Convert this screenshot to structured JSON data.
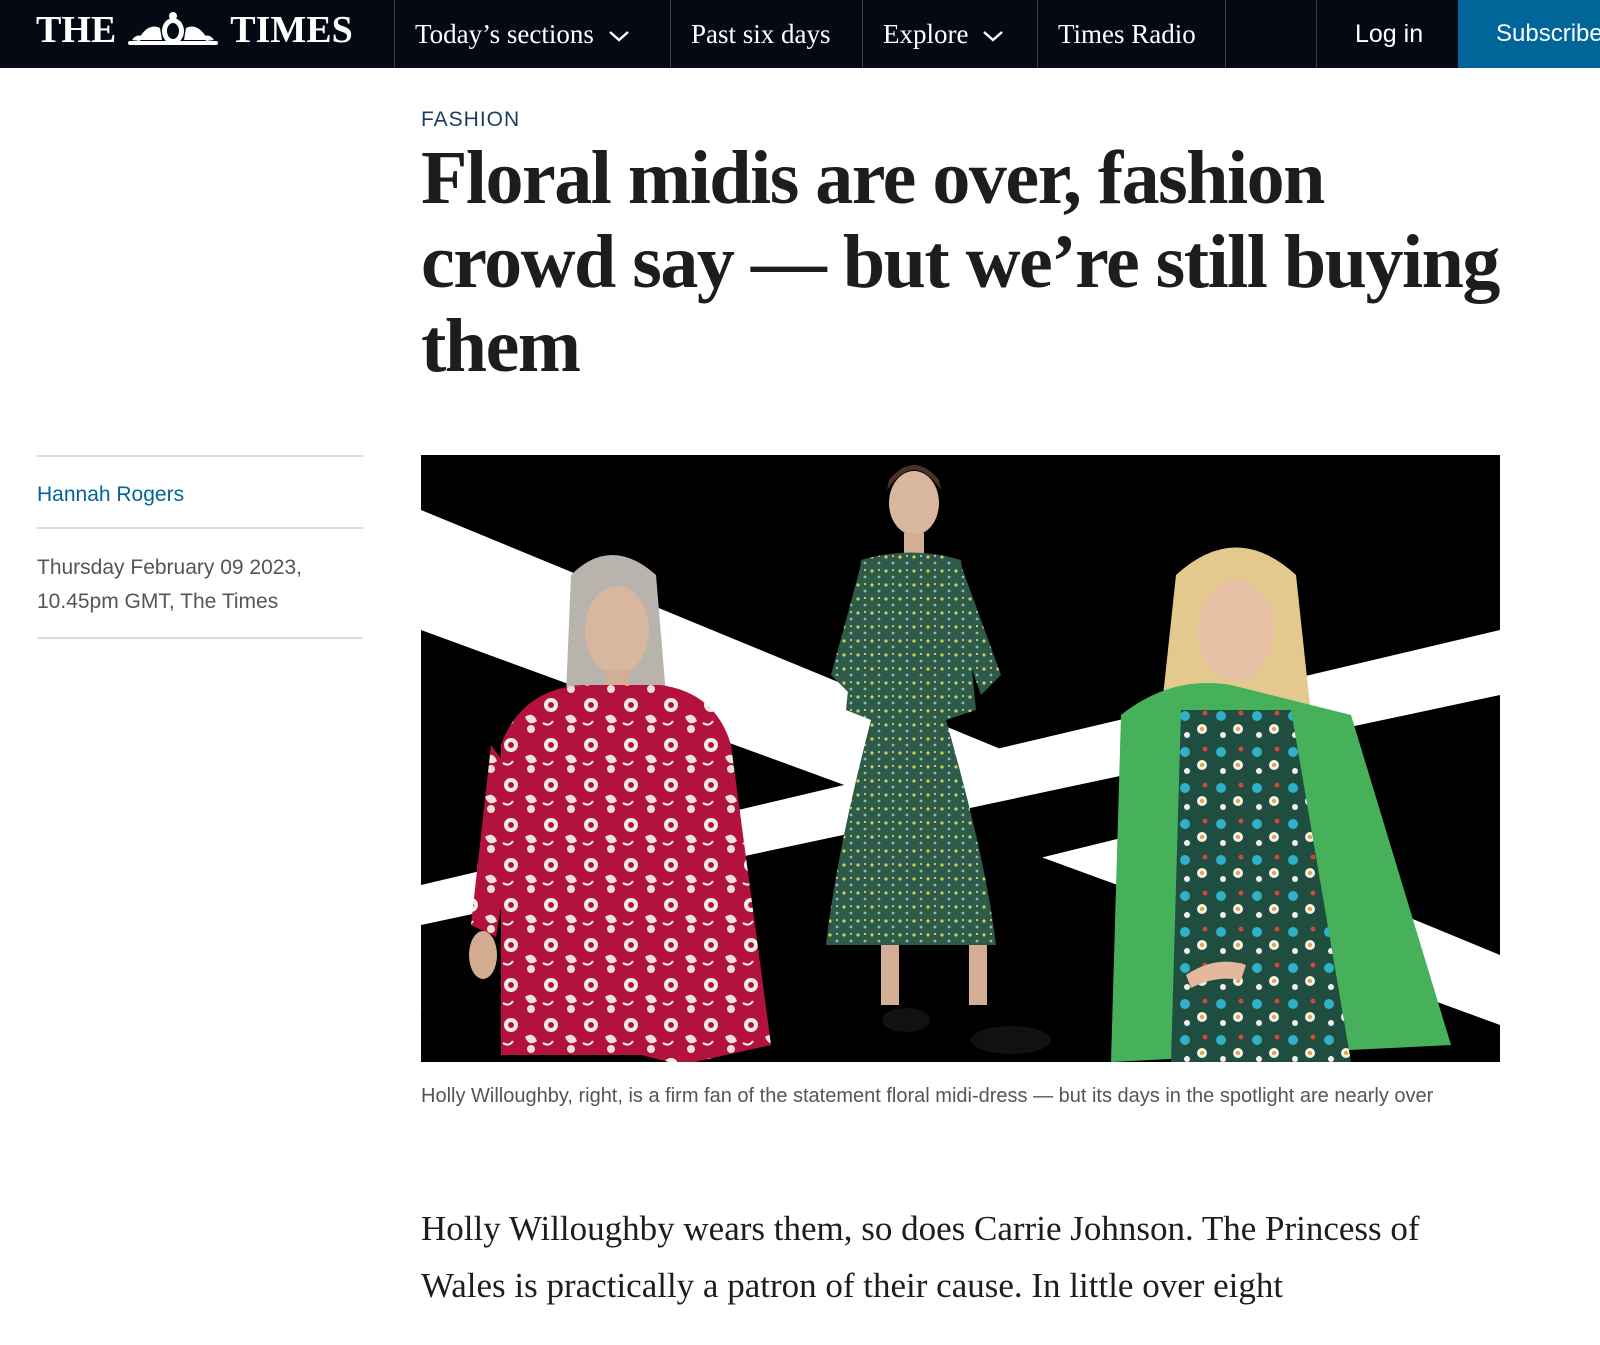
{
  "header": {
    "logo_left": "THE",
    "logo_right": "TIMES",
    "nav": [
      {
        "label": "Today’s sections",
        "has_dropdown": true
      },
      {
        "label": "Past six days",
        "has_dropdown": false
      },
      {
        "label": "Explore",
        "has_dropdown": true
      },
      {
        "label": "Times Radio",
        "has_dropdown": false
      }
    ],
    "login_label": "Log in",
    "subscribe_label": "Subscribe"
  },
  "article": {
    "section": "FASHION",
    "headline": "Floral midis are over, fashion crowd say — but we’re still buying them",
    "author": "Hannah Rogers",
    "dateline": "Thursday February 09 2023, 10.45pm GMT, The Times",
    "image_caption": "Holly Willoughby, right, is a firm fan of the statement floral midi-dress — but its days in the spotlight are nearly over",
    "body_first_para": "Holly Willoughby wears them, so does Carrie Johnson. The Princess of Wales is practically a patron of their cause. In little over eight"
  },
  "colors": {
    "nav_bg": "#050914",
    "subscribe_bg": "#006699",
    "link": "#006699",
    "section_label": "#1b3d5c"
  }
}
